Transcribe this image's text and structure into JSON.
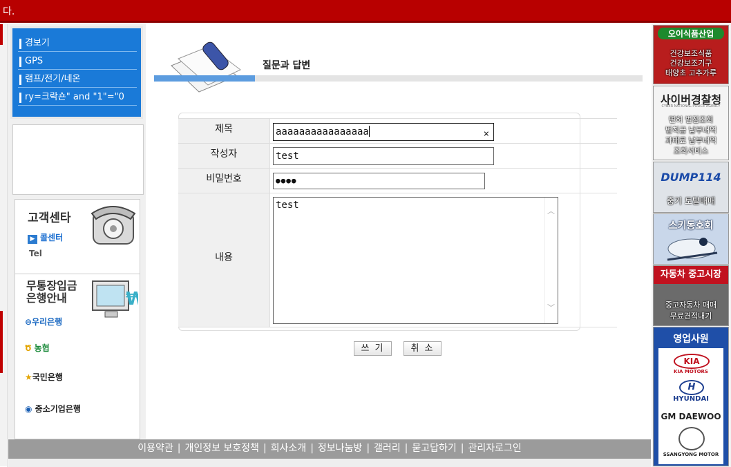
{
  "topbar": {
    "text": "다."
  },
  "menu": {
    "items": [
      {
        "label": "경보기"
      },
      {
        "label": "GPS"
      },
      {
        "label": "램프/전기/네온"
      },
      {
        "label": "ry=크락숀\" and \"1\"=\"0"
      }
    ]
  },
  "customer_center": {
    "title": "고객센타",
    "call_label": "콜센터",
    "tel_label": "Tel"
  },
  "bank_info": {
    "title": "무통장입금\n은행안내",
    "banks": [
      "우리은행",
      "농협",
      "국민은행",
      "중소기업은행"
    ]
  },
  "page": {
    "title": "질문과 답변"
  },
  "form": {
    "subject_label": "제목",
    "subject_value": "aaaaaaaaaaaaaaaa",
    "clear_glyph": "×",
    "author_label": "작성자",
    "author_value": "test",
    "password_label": "비밀번호",
    "password_value": "●●●●",
    "content_label": "내용",
    "content_value": "test"
  },
  "buttons": {
    "write": "쓰 기",
    "cancel": "취 소"
  },
  "footer": {
    "links": [
      "이용약관",
      "개인정보 보호정책",
      "회사소개",
      "정보나눔방",
      "갤러리",
      "묻고답하기",
      "관리자로그인"
    ],
    "separator": "|"
  },
  "ads": {
    "oi_brand": "오이식품산업",
    "oi_lines": [
      "건강보조식품",
      "건강보조기구",
      "태양초 고추가루"
    ],
    "police_title": "사이버경찰청",
    "police_sub": "CYBER NATIONAL POLICE AGENCY",
    "police_lines": [
      "면허 벌점조회",
      "범칙금 납부내역",
      "과태료 납부내역",
      "조회서비스"
    ],
    "dump_title": "DUMP114",
    "dump_sub": "중기 토탈매매",
    "ski_title": "스키동호회",
    "car_title": "자동차 중고시장",
    "car_lines": [
      "중고자동차 매매",
      "무료견적내기"
    ],
    "sales_title": "영업사원",
    "brands": [
      "KIA",
      "KIA MOTORS",
      "HYUNDAI",
      "GM DAEWOO",
      "SSANGYONG MOTOR"
    ]
  },
  "colors": {
    "topbar": "#b80000",
    "menu_bg": "#1a7ad8",
    "footer_bg": "#9b9b9b"
  }
}
